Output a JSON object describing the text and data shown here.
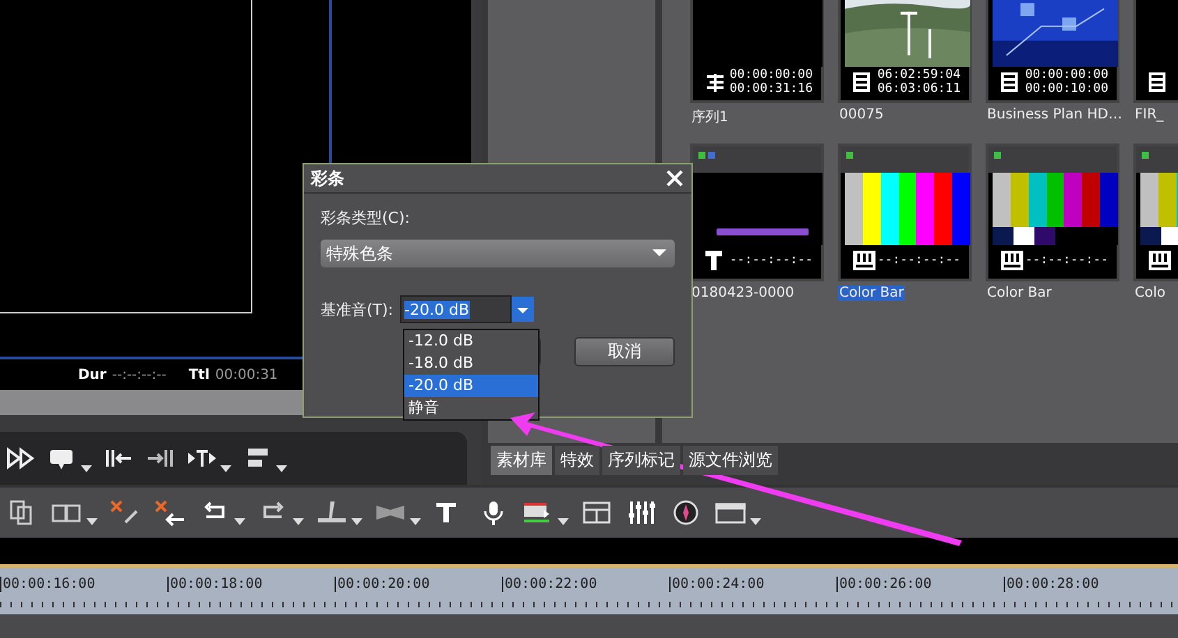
{
  "player": {
    "status": [
      {
        "label": "Dur",
        "value": "--:--:--:--"
      },
      {
        "label": "Ttl",
        "value": "00:00:31"
      }
    ]
  },
  "bin": {
    "rows": [
      [
        {
          "name": "序列1",
          "kind": "sequence",
          "timecodes": [
            "00:00:00:00",
            "00:00:31:16"
          ],
          "selected": false
        },
        {
          "name": "00075",
          "kind": "landscape-clip",
          "timecodes": [
            "06:02:59:04",
            "06:03:06:11"
          ],
          "selected": false
        },
        {
          "name": "Business Plan HD…",
          "kind": "graphic-clip",
          "timecodes": [
            "00:00:00:00",
            "00:00:10:00"
          ],
          "selected": false
        },
        {
          "name": "FIR_",
          "kind": "dark-clip",
          "selected": false
        }
      ],
      [
        {
          "name": "0180423-0000",
          "kind": "title",
          "timecodes": [
            "--:--:--:--"
          ],
          "selected": false,
          "dots": [
            {
              "color": "#3fbf3f"
            },
            {
              "color": "#3f6fcf"
            }
          ]
        },
        {
          "name": "Color Bar",
          "kind": "colorbar",
          "timecodes": [
            "--:--:--:--"
          ],
          "selected": true,
          "dots": [
            {
              "color": "#3fbf3f"
            }
          ]
        },
        {
          "name": "Color Bar",
          "kind": "smpte",
          "timecodes": [
            "--:--:--:--"
          ],
          "selected": false,
          "dots": [
            {
              "color": "#3fbf3f"
            }
          ]
        },
        {
          "name": "Colo",
          "kind": "smpte",
          "selected": false,
          "dots": [
            {
              "color": "#3fbf3f"
            }
          ]
        }
      ]
    ]
  },
  "bin_tabs": [
    {
      "label": "素材库",
      "selected": true
    },
    {
      "label": "特效",
      "selected": false
    },
    {
      "label": "序列标记",
      "selected": false
    },
    {
      "label": "源文件浏览",
      "selected": false
    }
  ],
  "timeline": {
    "ruler": [
      "00:00:16:00",
      "00:00:18:00",
      "00:00:20:00",
      "00:00:22:00",
      "00:00:24:00",
      "00:00:26:00",
      "00:00:28:00"
    ]
  },
  "dialog": {
    "title": "彩条",
    "type_label": "彩条类型(C):",
    "type_value": "特殊色条",
    "tone_label": "基准音(T):",
    "tone_value": "-20.0 dB",
    "tone_options": [
      {
        "label": "-12.0 dB",
        "selected": false
      },
      {
        "label": "-18.0 dB",
        "selected": false
      },
      {
        "label": "-20.0 dB",
        "selected": true
      },
      {
        "label": "静音",
        "selected": false
      }
    ],
    "cancel": "取消"
  }
}
